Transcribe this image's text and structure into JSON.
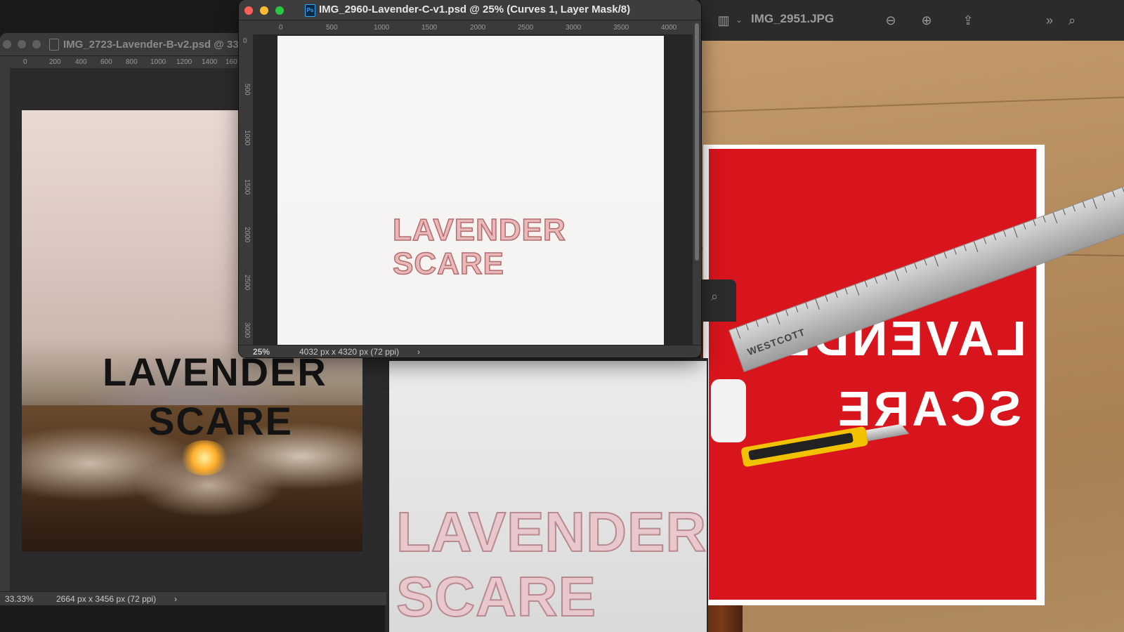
{
  "preview": {
    "title": "IMG_2951.JPG",
    "icons": [
      "sidebar-icon",
      "chevron-down-icon",
      "zoom-out-icon",
      "zoom-in-icon",
      "share-icon",
      "more-icon",
      "search-icon"
    ],
    "photo_text": {
      "line1": "LAVENDER",
      "line2": "SCARE"
    },
    "ruler_brand": "WESTCOTT"
  },
  "window_b": {
    "title": "IMG_2723-Lavender-B-v2.psd @ 33",
    "ruler_ticks": [
      "0",
      "200",
      "400",
      "600",
      "800",
      "1000",
      "1200",
      "1400",
      "160"
    ],
    "zoom": "33.33%",
    "dimensions": "2664 px x 3456 px (72 ppi)",
    "poster_text": {
      "line1": "LAVENDER",
      "line2": "SCARE"
    }
  },
  "window_c": {
    "title": "IMG_2960-Lavender-C-v1.psd @ 25% (Curves 1, Layer Mask/8)",
    "ps_badge": "Ps",
    "ruler_ticks": [
      "0",
      "500",
      "1000",
      "1500",
      "2000",
      "2500",
      "3000",
      "3500",
      "4000"
    ],
    "vruler_ticks": [
      "0",
      "500",
      "1000",
      "1500",
      "2000",
      "2500",
      "3000"
    ],
    "zoom": "25%",
    "dimensions": "4032 px x 4320 px (72 ppi)",
    "doc_text": {
      "line1": "LAVENDER",
      "line2": "SCARE"
    }
  },
  "stencil_photo": {
    "text": {
      "line1": "LAVENDER",
      "line2": "SCARE"
    }
  }
}
